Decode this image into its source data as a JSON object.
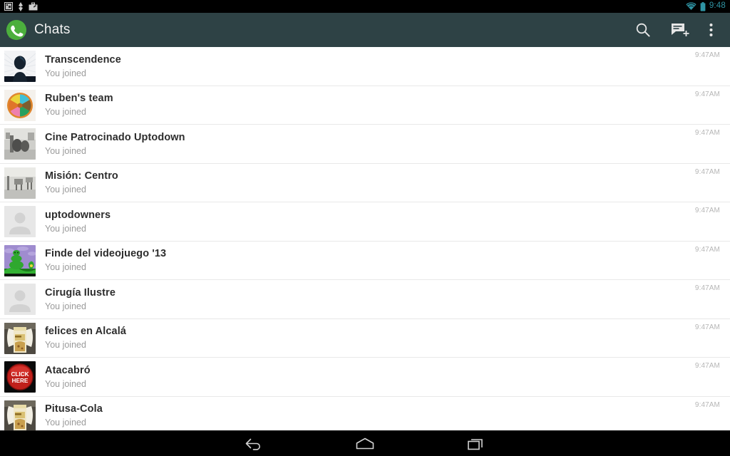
{
  "statusbar": {
    "left_icons": [
      "screenshot-icon",
      "usb-debug-icon",
      "briefcase-icon"
    ],
    "wifi_icon": "wifi-icon",
    "battery_icon": "battery-icon",
    "clock": "9:48",
    "accent_color": "#2f93a3",
    "background": "#000000"
  },
  "actionbar": {
    "logo_icon": "whatsapp-logo-icon",
    "title": "Chats",
    "background": "#2e4245",
    "actions": [
      {
        "name": "search-icon",
        "label": "Search"
      },
      {
        "name": "new-chat-icon",
        "label": "New chat"
      },
      {
        "name": "overflow-menu-icon",
        "label": "More options"
      }
    ]
  },
  "chats": [
    {
      "title": "Transcendence",
      "subtitle": "You joined",
      "time": "9:47AM",
      "avatar": "transcendence-poster"
    },
    {
      "title": "Ruben's team",
      "subtitle": "You joined",
      "time": "9:47AM",
      "avatar": "trivia-wheel"
    },
    {
      "title": "Cine Patrocinado Uptodown",
      "subtitle": "You joined",
      "time": "9:47AM",
      "avatar": "office-photo-dark"
    },
    {
      "title": "Misión: Centro",
      "subtitle": "You joined",
      "time": "9:47AM",
      "avatar": "office-photo-light"
    },
    {
      "title": "uptodowners",
      "subtitle": "You joined",
      "time": "9:47AM",
      "avatar": "default-person"
    },
    {
      "title": "Finde del videojuego '13",
      "subtitle": "You joined",
      "time": "9:47AM",
      "avatar": "game-art"
    },
    {
      "title": "Cirugía Ilustre",
      "subtitle": "You joined",
      "time": "9:47AM",
      "avatar": "default-person"
    },
    {
      "title": "felices en Alcalá",
      "subtitle": "You joined",
      "time": "9:47AM",
      "avatar": "snack-photo"
    },
    {
      "title": "Atacabró",
      "subtitle": "You joined",
      "time": "9:47AM",
      "avatar": "click-here-button",
      "avatar_text": [
        "CLICK",
        "HERE"
      ]
    },
    {
      "title": "Pitusa-Cola",
      "subtitle": "You joined",
      "time": "9:47AM",
      "avatar": "snack-photo"
    }
  ],
  "navbar": {
    "buttons": [
      {
        "name": "back-nav-icon",
        "label": "Back"
      },
      {
        "name": "home-nav-icon",
        "label": "Home"
      },
      {
        "name": "recents-nav-icon",
        "label": "Recent apps"
      }
    ],
    "background": "#000000"
  }
}
